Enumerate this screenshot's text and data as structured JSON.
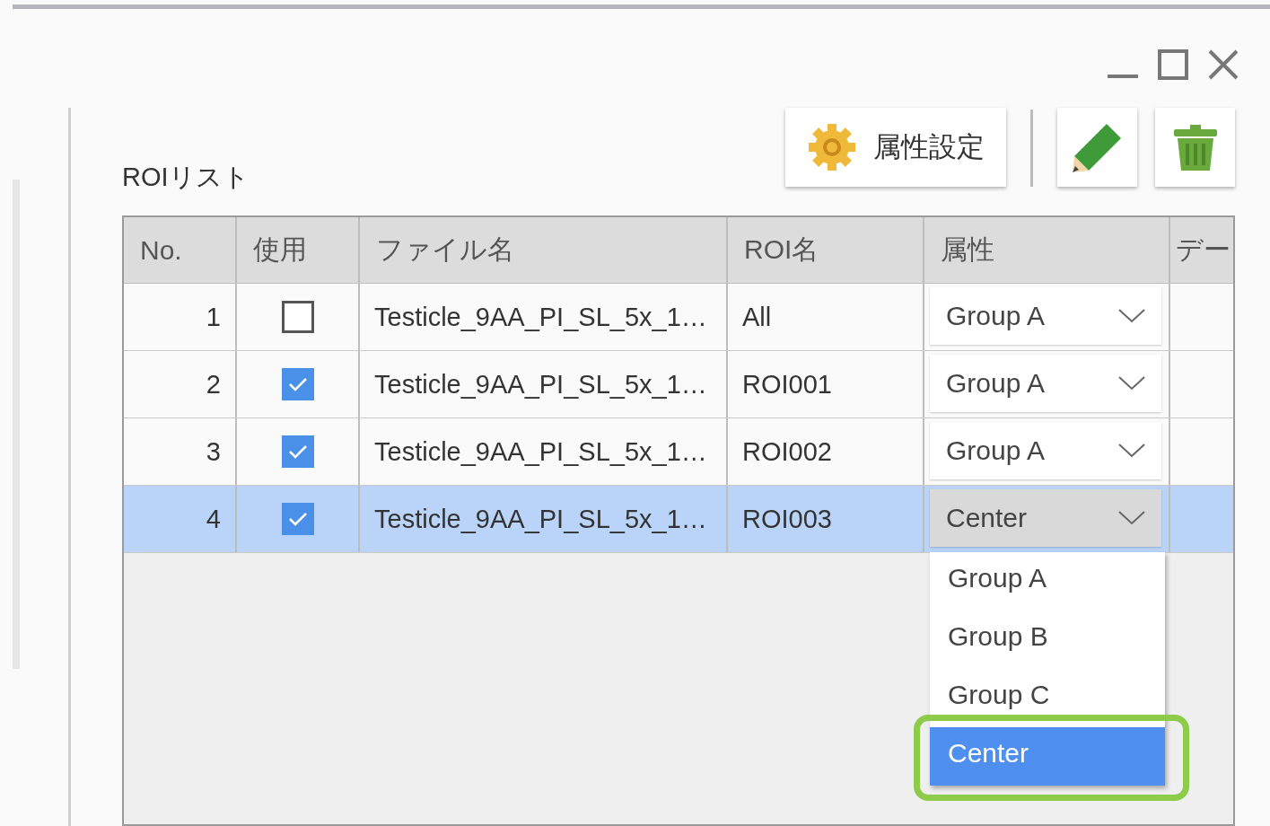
{
  "title": "ROIリスト",
  "toolbar": {
    "attribute_button": "属性設定"
  },
  "table": {
    "columns": [
      "No.",
      "使用",
      "ファイル名",
      "ROI名",
      "属性",
      "デー"
    ],
    "rows": [
      {
        "no": "1",
        "used": false,
        "file": "Testicle_9AA_PI_SL_5x_1…",
        "roi": "All",
        "attribute": "Group A",
        "open": false,
        "selected": false
      },
      {
        "no": "2",
        "used": true,
        "file": "Testicle_9AA_PI_SL_5x_1…",
        "roi": "ROI001",
        "attribute": "Group A",
        "open": false,
        "selected": false
      },
      {
        "no": "3",
        "used": true,
        "file": "Testicle_9AA_PI_SL_5x_1…",
        "roi": "ROI002",
        "attribute": "Group A",
        "open": false,
        "selected": false
      },
      {
        "no": "4",
        "used": true,
        "file": "Testicle_9AA_PI_SL_5x_1…",
        "roi": "ROI003",
        "attribute": "Center",
        "open": true,
        "selected": true
      }
    ]
  },
  "dropdown": {
    "options": [
      {
        "label": "Group A",
        "selected": false
      },
      {
        "label": "Group B",
        "selected": false
      },
      {
        "label": "Group C",
        "selected": false
      },
      {
        "label": "Center",
        "selected": true
      }
    ]
  }
}
